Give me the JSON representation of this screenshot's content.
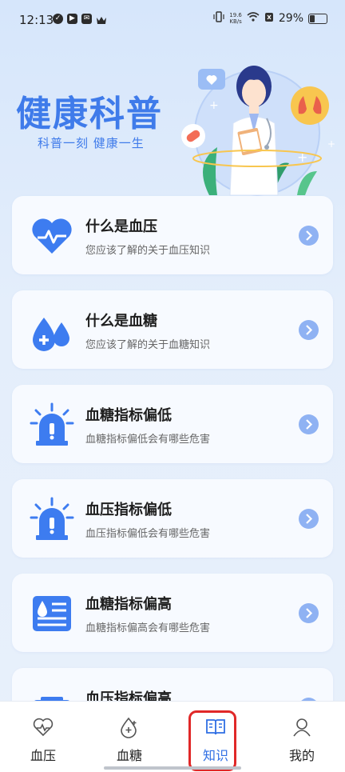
{
  "status_bar": {
    "time": "12:13",
    "net_speed_value": "19.6",
    "net_speed_unit": "KB/s",
    "battery": "29%"
  },
  "hero": {
    "title": "健康科普",
    "subtitle": "科普一刻  健康一生"
  },
  "cards": [
    {
      "title": "什么是血压",
      "desc": "您应该了解的关于血压知识",
      "icon": "heart-pulse-icon"
    },
    {
      "title": "什么是血糖",
      "desc": "您应该了解的关于血糖知识",
      "icon": "blood-drops-icon"
    },
    {
      "title": "血糖指标偏低",
      "desc": "血糖指标偏低会有哪些危害",
      "icon": "alarm-light-icon"
    },
    {
      "title": "血压指标偏低",
      "desc": "血压指标偏低会有哪些危害",
      "icon": "alarm-light-icon"
    },
    {
      "title": "血糖指标偏高",
      "desc": "血糖指标偏高会有哪些危害",
      "icon": "medical-report-icon"
    },
    {
      "title": "血压指标偏高",
      "desc": "",
      "icon": "medical-kit-icon"
    }
  ],
  "tabs": [
    {
      "label": "血压",
      "icon": "heart-pulse-outline-icon"
    },
    {
      "label": "血糖",
      "icon": "drop-plus-outline-icon"
    },
    {
      "label": "知识",
      "icon": "book-outline-icon",
      "active": true
    },
    {
      "label": "我的",
      "icon": "user-outline-icon"
    }
  ],
  "colors": {
    "accent": "#3f7bea",
    "icon_blue": "#3d7cf0",
    "arrow_bg": "#8fb2f3",
    "highlight": "#e02828"
  }
}
